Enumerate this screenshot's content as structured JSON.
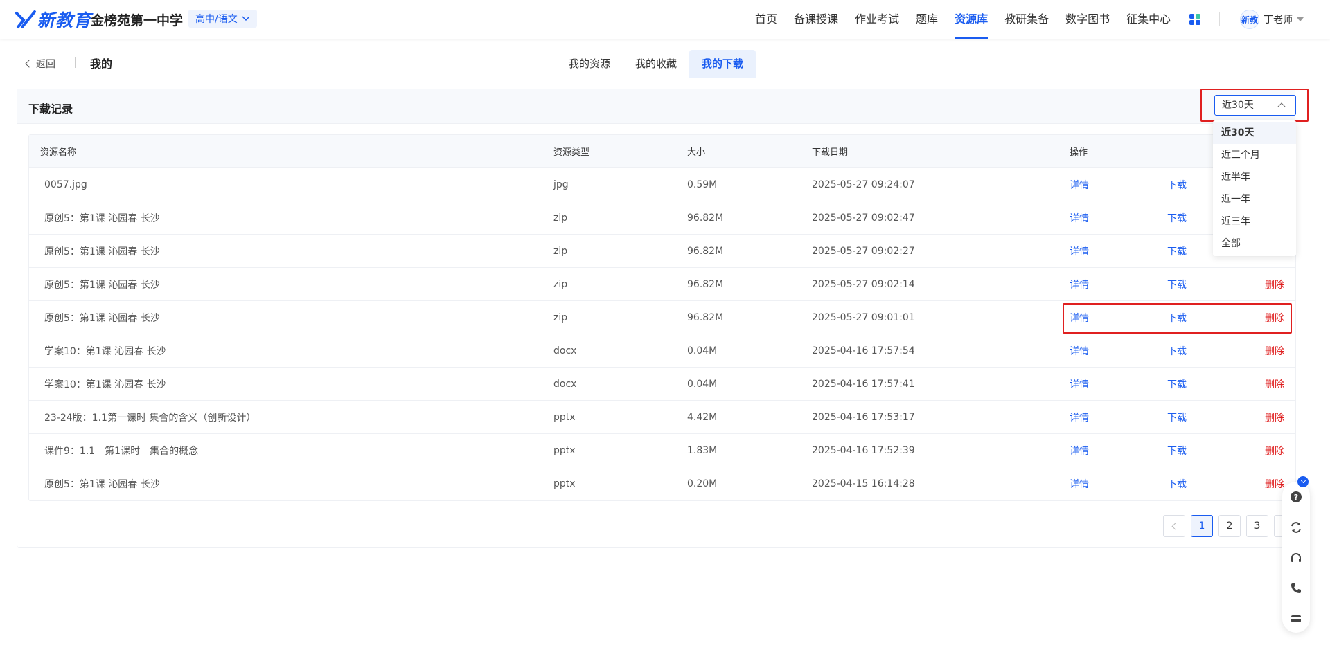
{
  "header": {
    "logo_text": "新教育",
    "school": "金榜苑第一中学",
    "grade_selector": "高中/语文",
    "nav": [
      "首页",
      "备课授课",
      "作业考试",
      "题库",
      "资源库",
      "教研集备",
      "数字图书",
      "征集中心"
    ],
    "active_nav": "资源库",
    "avatar_text": "新教",
    "user_name": "丁老师"
  },
  "subnav": {
    "back_label": "返回",
    "title": "我的",
    "tabs": [
      "我的资源",
      "我的收藏",
      "我的下载"
    ],
    "active_tab": "我的下载"
  },
  "panel": {
    "title": "下载记录",
    "date_filter": {
      "selected": "近30天",
      "options": [
        "近30天",
        "近三个月",
        "近半年",
        "近一年",
        "近三年",
        "全部"
      ]
    }
  },
  "table": {
    "headers": [
      "资源名称",
      "资源类型",
      "大小",
      "下载日期",
      "操作"
    ],
    "rows": [
      {
        "name": "0057.jpg",
        "type": "jpg",
        "size": "0.59M",
        "date": "2025-05-27 09:24:07"
      },
      {
        "name": "原创5：第1课 沁园春 长沙",
        "type": "zip",
        "size": "96.82M",
        "date": "2025-05-27 09:02:47"
      },
      {
        "name": "原创5：第1课 沁园春 长沙",
        "type": "zip",
        "size": "96.82M",
        "date": "2025-05-27 09:02:27"
      },
      {
        "name": "原创5：第1课 沁园春 长沙",
        "type": "zip",
        "size": "96.82M",
        "date": "2025-05-27 09:02:14"
      },
      {
        "name": "原创5：第1课 沁园春 长沙",
        "type": "zip",
        "size": "96.82M",
        "date": "2025-05-27 09:01:01"
      },
      {
        "name": "学案10：第1课 沁园春 长沙",
        "type": "docx",
        "size": "0.04M",
        "date": "2025-04-16 17:57:54"
      },
      {
        "name": "学案10：第1课 沁园春 长沙",
        "type": "docx",
        "size": "0.04M",
        "date": "2025-04-16 17:57:41"
      },
      {
        "name": "23-24版：1.1第一课时 集合的含义（创新设计）",
        "type": "pptx",
        "size": "4.42M",
        "date": "2025-04-16 17:53:17"
      },
      {
        "name": "课件9：1.1　第1课时　集合的概念",
        "type": "pptx",
        "size": "1.83M",
        "date": "2025-04-16 17:52:39"
      },
      {
        "name": "原创5：第1课 沁园春 长沙",
        "type": "pptx",
        "size": "0.20M",
        "date": "2025-04-15 16:14:28"
      }
    ],
    "actions": {
      "detail": "详情",
      "download": "下载",
      "delete": "删除"
    }
  },
  "pagination": {
    "pages": [
      "1",
      "2",
      "3"
    ],
    "current": "1"
  },
  "colors": {
    "accent": "#1a5cf0",
    "danger": "#e02020",
    "highlight": "#e02020"
  },
  "float_toolbar_icons": [
    "help-icon",
    "refresh-icon",
    "headset-icon",
    "phone-icon",
    "card-icon"
  ]
}
